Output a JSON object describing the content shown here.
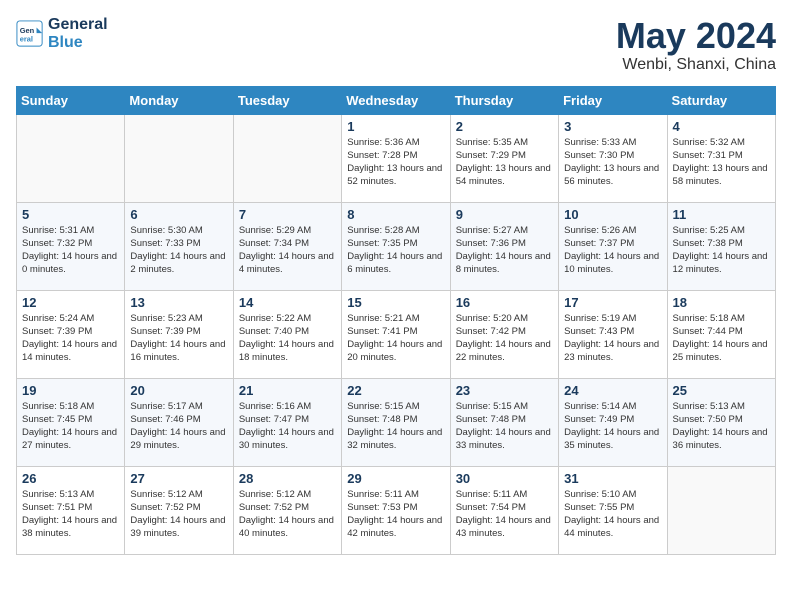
{
  "header": {
    "logo_line1": "General",
    "logo_line2": "Blue",
    "month": "May 2024",
    "location": "Wenbi, Shanxi, China"
  },
  "weekdays": [
    "Sunday",
    "Monday",
    "Tuesday",
    "Wednesday",
    "Thursday",
    "Friday",
    "Saturday"
  ],
  "weeks": [
    [
      {
        "day": "",
        "sunrise": "",
        "sunset": "",
        "daylight": ""
      },
      {
        "day": "",
        "sunrise": "",
        "sunset": "",
        "daylight": ""
      },
      {
        "day": "",
        "sunrise": "",
        "sunset": "",
        "daylight": ""
      },
      {
        "day": "1",
        "sunrise": "Sunrise: 5:36 AM",
        "sunset": "Sunset: 7:28 PM",
        "daylight": "Daylight: 13 hours and 52 minutes."
      },
      {
        "day": "2",
        "sunrise": "Sunrise: 5:35 AM",
        "sunset": "Sunset: 7:29 PM",
        "daylight": "Daylight: 13 hours and 54 minutes."
      },
      {
        "day": "3",
        "sunrise": "Sunrise: 5:33 AM",
        "sunset": "Sunset: 7:30 PM",
        "daylight": "Daylight: 13 hours and 56 minutes."
      },
      {
        "day": "4",
        "sunrise": "Sunrise: 5:32 AM",
        "sunset": "Sunset: 7:31 PM",
        "daylight": "Daylight: 13 hours and 58 minutes."
      }
    ],
    [
      {
        "day": "5",
        "sunrise": "Sunrise: 5:31 AM",
        "sunset": "Sunset: 7:32 PM",
        "daylight": "Daylight: 14 hours and 0 minutes."
      },
      {
        "day": "6",
        "sunrise": "Sunrise: 5:30 AM",
        "sunset": "Sunset: 7:33 PM",
        "daylight": "Daylight: 14 hours and 2 minutes."
      },
      {
        "day": "7",
        "sunrise": "Sunrise: 5:29 AM",
        "sunset": "Sunset: 7:34 PM",
        "daylight": "Daylight: 14 hours and 4 minutes."
      },
      {
        "day": "8",
        "sunrise": "Sunrise: 5:28 AM",
        "sunset": "Sunset: 7:35 PM",
        "daylight": "Daylight: 14 hours and 6 minutes."
      },
      {
        "day": "9",
        "sunrise": "Sunrise: 5:27 AM",
        "sunset": "Sunset: 7:36 PM",
        "daylight": "Daylight: 14 hours and 8 minutes."
      },
      {
        "day": "10",
        "sunrise": "Sunrise: 5:26 AM",
        "sunset": "Sunset: 7:37 PM",
        "daylight": "Daylight: 14 hours and 10 minutes."
      },
      {
        "day": "11",
        "sunrise": "Sunrise: 5:25 AM",
        "sunset": "Sunset: 7:38 PM",
        "daylight": "Daylight: 14 hours and 12 minutes."
      }
    ],
    [
      {
        "day": "12",
        "sunrise": "Sunrise: 5:24 AM",
        "sunset": "Sunset: 7:39 PM",
        "daylight": "Daylight: 14 hours and 14 minutes."
      },
      {
        "day": "13",
        "sunrise": "Sunrise: 5:23 AM",
        "sunset": "Sunset: 7:39 PM",
        "daylight": "Daylight: 14 hours and 16 minutes."
      },
      {
        "day": "14",
        "sunrise": "Sunrise: 5:22 AM",
        "sunset": "Sunset: 7:40 PM",
        "daylight": "Daylight: 14 hours and 18 minutes."
      },
      {
        "day": "15",
        "sunrise": "Sunrise: 5:21 AM",
        "sunset": "Sunset: 7:41 PM",
        "daylight": "Daylight: 14 hours and 20 minutes."
      },
      {
        "day": "16",
        "sunrise": "Sunrise: 5:20 AM",
        "sunset": "Sunset: 7:42 PM",
        "daylight": "Daylight: 14 hours and 22 minutes."
      },
      {
        "day": "17",
        "sunrise": "Sunrise: 5:19 AM",
        "sunset": "Sunset: 7:43 PM",
        "daylight": "Daylight: 14 hours and 23 minutes."
      },
      {
        "day": "18",
        "sunrise": "Sunrise: 5:18 AM",
        "sunset": "Sunset: 7:44 PM",
        "daylight": "Daylight: 14 hours and 25 minutes."
      }
    ],
    [
      {
        "day": "19",
        "sunrise": "Sunrise: 5:18 AM",
        "sunset": "Sunset: 7:45 PM",
        "daylight": "Daylight: 14 hours and 27 minutes."
      },
      {
        "day": "20",
        "sunrise": "Sunrise: 5:17 AM",
        "sunset": "Sunset: 7:46 PM",
        "daylight": "Daylight: 14 hours and 29 minutes."
      },
      {
        "day": "21",
        "sunrise": "Sunrise: 5:16 AM",
        "sunset": "Sunset: 7:47 PM",
        "daylight": "Daylight: 14 hours and 30 minutes."
      },
      {
        "day": "22",
        "sunrise": "Sunrise: 5:15 AM",
        "sunset": "Sunset: 7:48 PM",
        "daylight": "Daylight: 14 hours and 32 minutes."
      },
      {
        "day": "23",
        "sunrise": "Sunrise: 5:15 AM",
        "sunset": "Sunset: 7:48 PM",
        "daylight": "Daylight: 14 hours and 33 minutes."
      },
      {
        "day": "24",
        "sunrise": "Sunrise: 5:14 AM",
        "sunset": "Sunset: 7:49 PM",
        "daylight": "Daylight: 14 hours and 35 minutes."
      },
      {
        "day": "25",
        "sunrise": "Sunrise: 5:13 AM",
        "sunset": "Sunset: 7:50 PM",
        "daylight": "Daylight: 14 hours and 36 minutes."
      }
    ],
    [
      {
        "day": "26",
        "sunrise": "Sunrise: 5:13 AM",
        "sunset": "Sunset: 7:51 PM",
        "daylight": "Daylight: 14 hours and 38 minutes."
      },
      {
        "day": "27",
        "sunrise": "Sunrise: 5:12 AM",
        "sunset": "Sunset: 7:52 PM",
        "daylight": "Daylight: 14 hours and 39 minutes."
      },
      {
        "day": "28",
        "sunrise": "Sunrise: 5:12 AM",
        "sunset": "Sunset: 7:52 PM",
        "daylight": "Daylight: 14 hours and 40 minutes."
      },
      {
        "day": "29",
        "sunrise": "Sunrise: 5:11 AM",
        "sunset": "Sunset: 7:53 PM",
        "daylight": "Daylight: 14 hours and 42 minutes."
      },
      {
        "day": "30",
        "sunrise": "Sunrise: 5:11 AM",
        "sunset": "Sunset: 7:54 PM",
        "daylight": "Daylight: 14 hours and 43 minutes."
      },
      {
        "day": "31",
        "sunrise": "Sunrise: 5:10 AM",
        "sunset": "Sunset: 7:55 PM",
        "daylight": "Daylight: 14 hours and 44 minutes."
      },
      {
        "day": "",
        "sunrise": "",
        "sunset": "",
        "daylight": ""
      }
    ]
  ]
}
